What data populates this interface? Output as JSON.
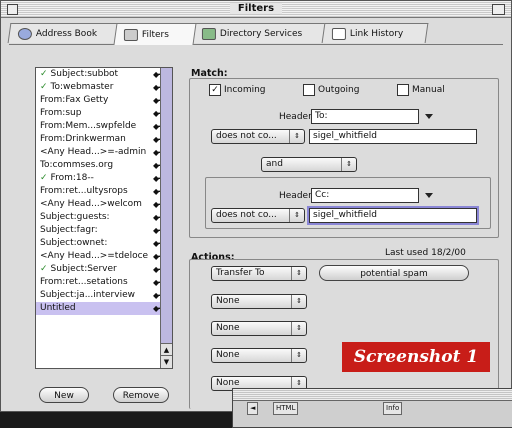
{
  "window": {
    "title": "Filters"
  },
  "tabs": [
    {
      "label": "Address Book",
      "icon": "address-book-icon"
    },
    {
      "label": "Filters",
      "icon": "filters-icon"
    },
    {
      "label": "Directory Services",
      "icon": "directory-services-icon"
    },
    {
      "label": "Link History",
      "icon": "link-history-icon"
    }
  ],
  "rules": [
    {
      "label": "Subject:subbot",
      "checked": true
    },
    {
      "label": "To:webmaster",
      "checked": true
    },
    {
      "label": "From:Fax Getty",
      "checked": false
    },
    {
      "label": "From:sup",
      "checked": false
    },
    {
      "label": "From:Mem...swpfelde",
      "checked": false
    },
    {
      "label": "From:Drinkwerman",
      "checked": false
    },
    {
      "label": "<Any Head...>=-admin",
      "checked": false
    },
    {
      "label": "To:commses.org",
      "checked": false
    },
    {
      "label": "From:18--",
      "checked": true
    },
    {
      "label": "From:ret...ultysrops",
      "checked": false
    },
    {
      "label": "<Any Head...>welcom",
      "checked": false
    },
    {
      "label": "Subject:guests:",
      "checked": false
    },
    {
      "label": "Subject:fagr:",
      "checked": false
    },
    {
      "label": "Subject:ownet:",
      "checked": false
    },
    {
      "label": "<Any Head...>=tdeloce",
      "checked": false
    },
    {
      "label": "Subject:Server",
      "checked": true
    },
    {
      "label": "From:ret...setations",
      "checked": false
    },
    {
      "label": "Subject:ja...interview",
      "checked": false
    },
    {
      "label": "Untitled",
      "checked": false
    }
  ],
  "buttons": {
    "new": "New",
    "remove": "Remove"
  },
  "match": {
    "label": "Match:",
    "incoming": "Incoming",
    "outgoing": "Outgoing",
    "manual": "Manual",
    "incoming_checked": true,
    "header_label_1": "Header:",
    "header_value_1": "To:",
    "condition_1": "does not co...",
    "value_1": "sigel_whitfield",
    "conjunction": "and",
    "header_label_2": "Header:",
    "header_value_2": "Cc:",
    "condition_2": "does not co...",
    "value_2": "sigel_whitfield"
  },
  "actions": {
    "label": "Actions:",
    "last_used": "Last used 18/2/00",
    "action_1": "Transfer To",
    "mailbox": "potential spam",
    "none_label": "None"
  },
  "badge": "Screenshot 1",
  "second_window": {
    "tool1": "HTML",
    "tool2": "Info"
  }
}
